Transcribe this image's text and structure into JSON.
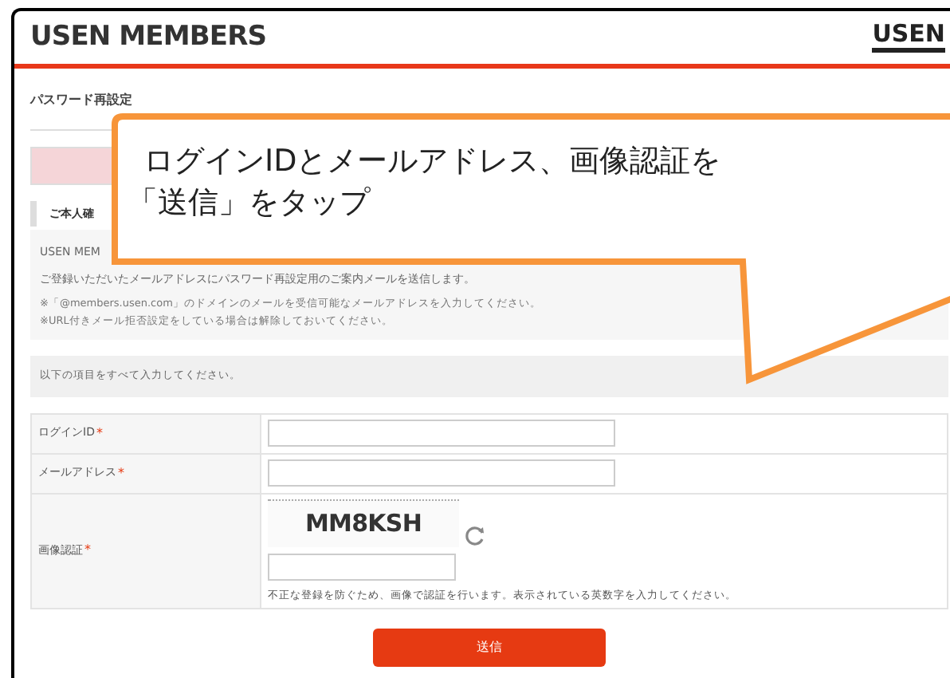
{
  "header": {
    "title": "USEN MEMBERS",
    "logo": "USEN"
  },
  "breadcrumb": "パスワード再設定",
  "section_heading": "ご本人確",
  "intro": {
    "lines": [
      "USEN MEM",
      "ご登録いただいたメールアドレスにパスワード再設定用のご案内メールを送信します。"
    ],
    "notes": [
      "※「@members.usen.com」のドメインのメールを受信可能なメールアドレスを入力してください。",
      "※URL付きメール拒否設定をしている場合は解除しておいてください。"
    ]
  },
  "instruction": "以下の項目をすべて入力してください。",
  "form": {
    "rows": [
      {
        "kind": "text",
        "label": "ログインID",
        "required_mark": "*"
      },
      {
        "kind": "text",
        "label": "メールアドレス",
        "required_mark": "*"
      },
      {
        "kind": "captcha",
        "label": "画像認証",
        "required_mark": "*",
        "captcha": "MM8KSH",
        "note": "不正な登録を防ぐため、画像で認証を行います。表示されている英数字を入力してください。"
      }
    ]
  },
  "submit": "送信",
  "callout": {
    "lines": [
      "ログインIDとメールアドレス、画像認証を",
      "「送信」をタップ"
    ]
  }
}
